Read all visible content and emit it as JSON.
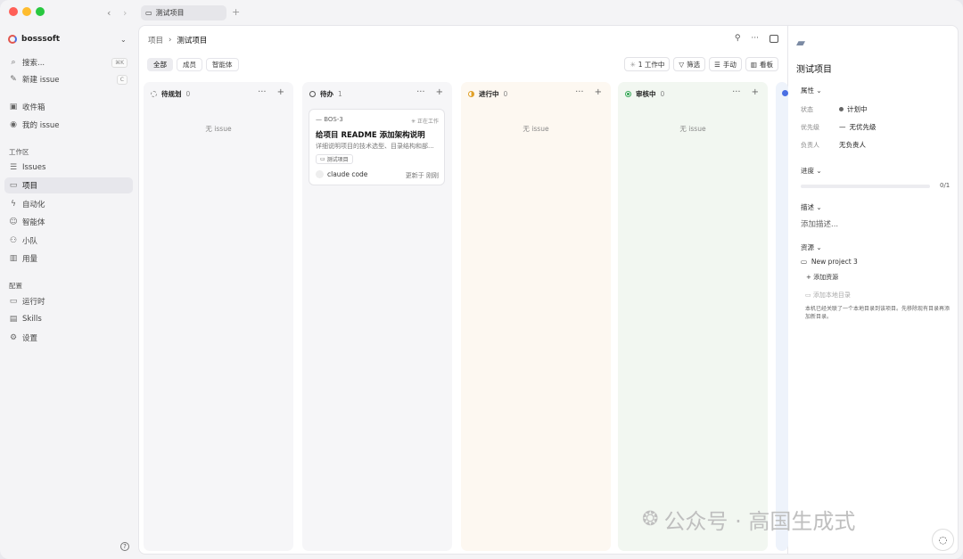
{
  "titlebar": {
    "tab_label": "测试项目"
  },
  "sidebar": {
    "workspace": "bosssoft",
    "search": {
      "label": "搜索...",
      "shortcut": "⌘K"
    },
    "new_issue": {
      "label": "新建 issue",
      "shortcut": "C"
    },
    "inbox": "收件箱",
    "my_issues": "我的 issue",
    "workspace_section": "工作区",
    "nav": [
      "Issues",
      "项目",
      "自动化",
      "智能体",
      "小队",
      "用量"
    ],
    "config_section": "配置",
    "config": [
      "运行时",
      "Skills",
      "设置"
    ]
  },
  "main": {
    "breadcrumb": {
      "parent": "项目",
      "current": "测试项目"
    },
    "filters": [
      "全部",
      "成员",
      "智能体"
    ],
    "toolbar": {
      "working": "1 工作中",
      "filter": "筛选",
      "manual": "手动",
      "board": "看板"
    },
    "columns": [
      {
        "name": "待规划",
        "count": "0",
        "empty": "无 issue"
      },
      {
        "name": "待办",
        "count": "1",
        "empty": ""
      },
      {
        "name": "进行中",
        "count": "0",
        "empty": "无 issue"
      },
      {
        "name": "审核中",
        "count": "0",
        "empty": "无 issue"
      }
    ],
    "card": {
      "id": "BOS-3",
      "status": "正在工作",
      "title": "给项目 README 添加架构说明",
      "desc": "详细说明项目的技术选型、目录结构和部...",
      "tag": "测试项目",
      "agent": "claude code",
      "updated": "更新于 刚刚"
    }
  },
  "panel": {
    "title": "测试项目",
    "properties": "属性",
    "status_label": "状态",
    "status_value": "计划中",
    "priority_label": "优先级",
    "priority_value": "无优先级",
    "owner_label": "负责人",
    "owner_value": "无负责人",
    "progress": "进度",
    "progress_value": "0/1",
    "progress_fraction": 0,
    "description": "描述",
    "description_placeholder": "添加描述...",
    "resources": "资源",
    "resource_item": "New project 3",
    "add_resource": "添加资源",
    "add_local": "添加本地目录",
    "note": "本机已经关联了一个本地目录到该项目。先移除现有目录再添加新目录。"
  },
  "watermark": "公众号 · 高国生成式",
  "colors": {
    "accent": "#4a6fe3",
    "red": "#ff5f57",
    "yellow": "#febc2e",
    "green": "#28c840"
  }
}
